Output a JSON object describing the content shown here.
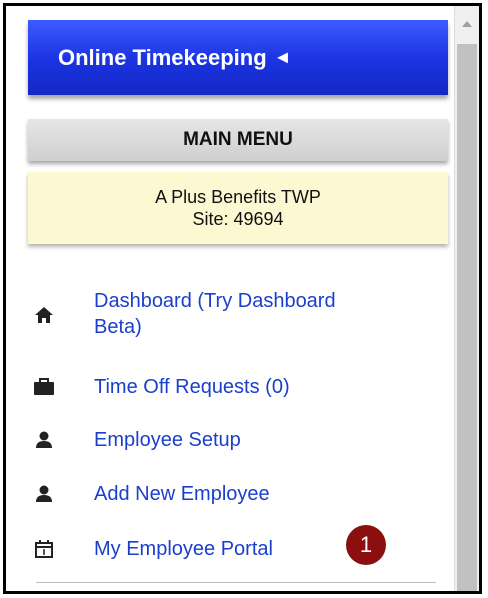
{
  "header": {
    "title": "Online Timekeeping",
    "collapse_arrow": "◄"
  },
  "main_menu": {
    "title": "MAIN MENU"
  },
  "site_info": {
    "company": "A Plus Benefits TWP",
    "site": "Site: 49694"
  },
  "nav": {
    "items": [
      {
        "label": "Dashboard (Try Dashboard",
        "label_line2": "Beta)",
        "icon": "home-icon"
      },
      {
        "label": "Time Off Requests (0)",
        "icon": "briefcase-icon"
      },
      {
        "label": "Employee Setup",
        "icon": "user-icon"
      },
      {
        "label": "Add New Employee",
        "icon": "user-icon"
      },
      {
        "label": "My Employee Portal",
        "icon": "calendar-icon"
      }
    ]
  },
  "annotation": {
    "badge": "1",
    "color": "#8b0f0f"
  },
  "colors": {
    "header_blue": "#1a33e0",
    "link_blue": "#1a3fcc",
    "site_bg": "#fbf8d2"
  }
}
